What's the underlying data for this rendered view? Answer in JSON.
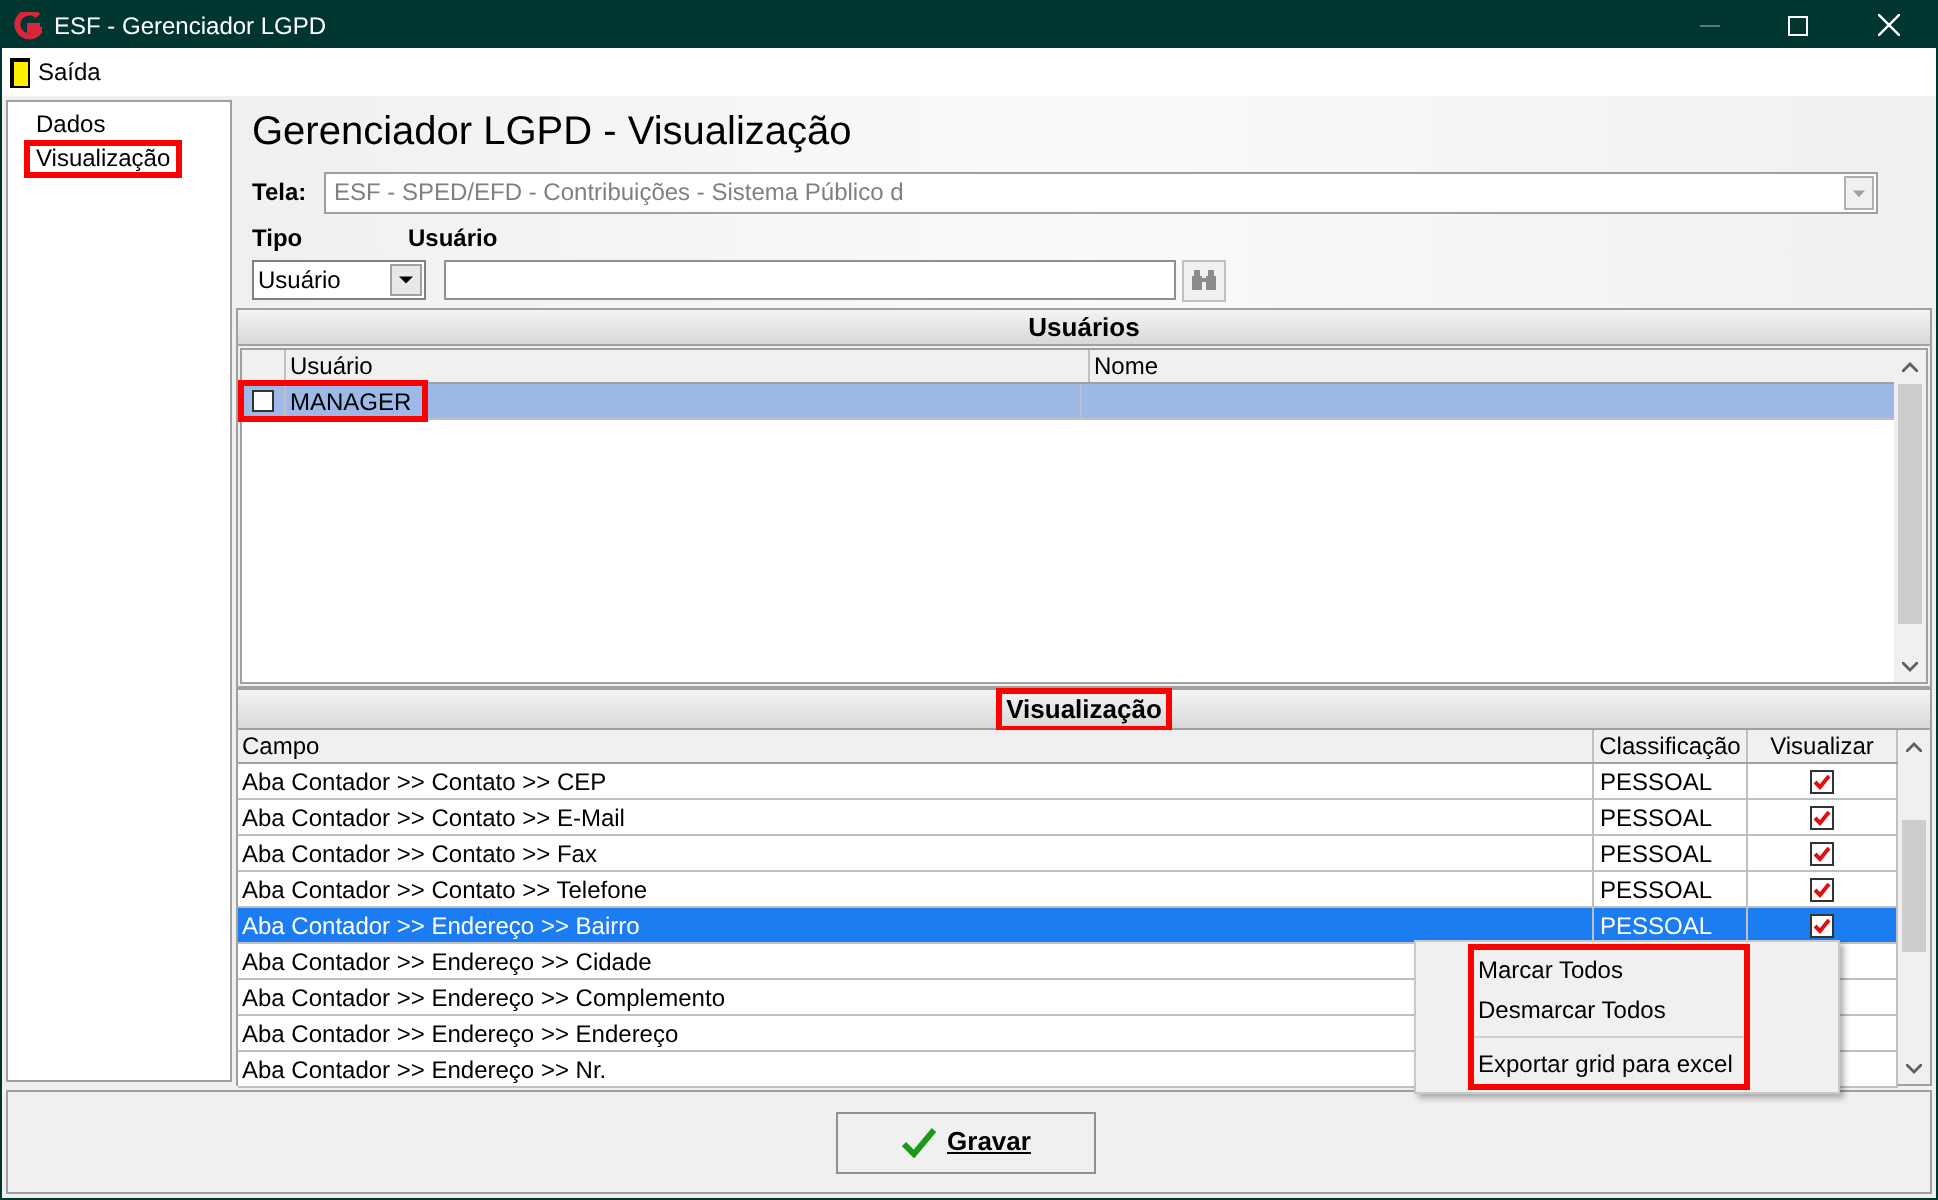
{
  "window": {
    "title": "ESF - Gerenciador LGPD"
  },
  "menu": [
    {
      "label": "Saída"
    }
  ],
  "sidebar": {
    "items": [
      {
        "label": "Dados",
        "annotated": false
      },
      {
        "label": "Visualização",
        "annotated": true
      }
    ]
  },
  "heading": "Gerenciador LGPD - Visualização",
  "tela": {
    "label": "Tela:",
    "value": "ESF - SPED/EFD - Contribuições - Sistema Público d"
  },
  "tipo": {
    "label": "Tipo",
    "value": "Usuário"
  },
  "usuario": {
    "label": "Usuário"
  },
  "users_panel": {
    "title": "Usuários",
    "columns": [
      "Usuário",
      "Nome"
    ],
    "rows": [
      {
        "usuario": "MANAGER",
        "checked": false,
        "selected": true,
        "annotated": true
      }
    ]
  },
  "view_panel": {
    "title": "Visualização",
    "annotated": true,
    "columns": [
      "Campo",
      "Classificação",
      "Visualizar"
    ],
    "rows": [
      {
        "campo": "Aba Contador >> Contato >> CEP",
        "classificacao": "PESSOAL",
        "visualizar": true,
        "selected": false
      },
      {
        "campo": "Aba Contador >> Contato >> E-Mail",
        "classificacao": "PESSOAL",
        "visualizar": true,
        "selected": false
      },
      {
        "campo": "Aba Contador >> Contato >> Fax",
        "classificacao": "PESSOAL",
        "visualizar": true,
        "selected": false
      },
      {
        "campo": "Aba Contador >> Contato >> Telefone",
        "classificacao": "PESSOAL",
        "visualizar": true,
        "selected": false
      },
      {
        "campo": "Aba Contador >> Endereço >> Bairro",
        "classificacao": "PESSOAL",
        "visualizar": true,
        "selected": true
      },
      {
        "campo": "Aba Contador >> Endereço >> Cidade",
        "selected": false
      },
      {
        "campo": "Aba Contador >> Endereço >> Complemento",
        "selected": false
      },
      {
        "campo": "Aba Contador >> Endereço >> Endereço",
        "selected": false
      },
      {
        "campo": "Aba Contador >> Endereço >> Nr.",
        "selected": false
      }
    ]
  },
  "context_menu": {
    "annotated": true,
    "items": [
      {
        "kind": "item",
        "label": "Marcar Todos"
      },
      {
        "kind": "item",
        "label": "Desmarcar Todos"
      },
      {
        "kind": "separator"
      },
      {
        "kind": "item",
        "label": "Exportar grid para excel"
      }
    ]
  },
  "save_button": {
    "label": "Gravar"
  }
}
